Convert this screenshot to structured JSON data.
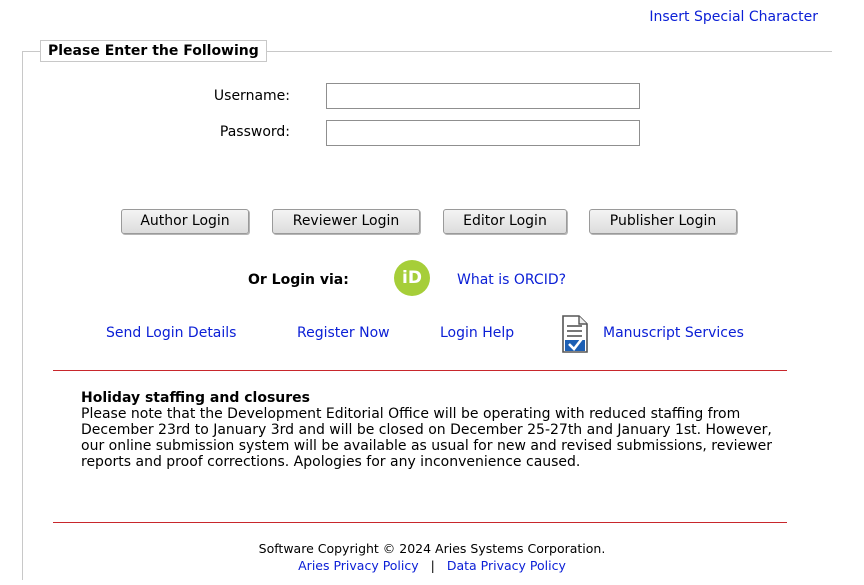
{
  "header": {
    "special_char_link": "Insert Special Character"
  },
  "form": {
    "legend": "Please Enter the Following",
    "username_label": "Username:",
    "password_label": "Password:",
    "username_value": "",
    "password_value": ""
  },
  "buttons": {
    "author": "Author Login",
    "reviewer": "Reviewer Login",
    "editor": "Editor Login",
    "publisher": "Publisher Login"
  },
  "orcid": {
    "prompt": "Or Login via:",
    "icon_text": "iD",
    "what_is": "What is ORCID?"
  },
  "links": {
    "send_login": "Send Login Details",
    "register": "Register Now",
    "login_help": "Login Help",
    "manuscript_services": "Manuscript Services"
  },
  "notice": {
    "title": "Holiday staffing and closures",
    "body": "Please note that the Development Editorial Office will be operating with reduced staffing from December 23rd to January 3rd and will be closed on December 25-27th and January 1st. However, our online submission system will be available as usual for new and revised submissions, reviewer reports and proof corrections. Apologies for any inconvenience caused."
  },
  "footer": {
    "copyright": "Software Copyright © 2024 Aries Systems Corporation.",
    "aries_privacy": "Aries Privacy Policy",
    "separator": "|",
    "data_privacy": "Data Privacy Policy"
  },
  "colors": {
    "link": "#0c20d6",
    "rule": "#c8272c",
    "orcid": "#a6ce39"
  }
}
